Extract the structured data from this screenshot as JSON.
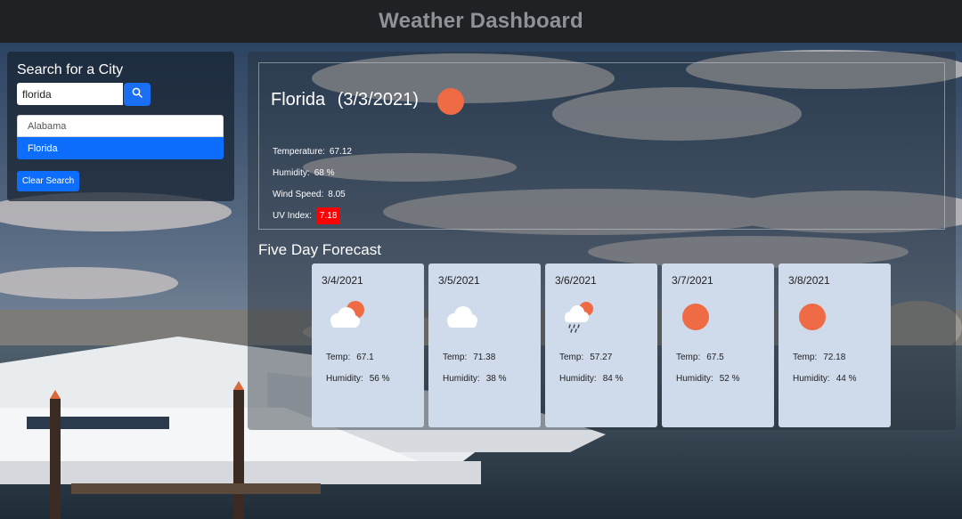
{
  "header": {
    "title": "Weather Dashboard"
  },
  "search": {
    "title": "Search for a City",
    "input_value": "florida",
    "history": [
      "Alabama",
      "Florida"
    ],
    "active_index": 1,
    "clear_label": "Clear Search"
  },
  "current": {
    "city": "Florida",
    "date": "(3/3/2021)",
    "icon": "sun-icon",
    "temperature_label": "Temperature:",
    "temperature": "67.12",
    "humidity_label": "Humidity:",
    "humidity": "68 %",
    "wind_label": "Wind Speed:",
    "wind": "8.05",
    "uv_label": "UV Index:",
    "uv": "7.18",
    "uv_color": "#ff0000"
  },
  "forecast": {
    "title": "Five Day Forecast",
    "temp_label": "Temp:",
    "humidity_label": "Humidity:",
    "days": [
      {
        "date": "3/4/2021",
        "icon": "partly-cloudy-icon",
        "temp": "67.1",
        "humidity": "56 %"
      },
      {
        "date": "3/5/2021",
        "icon": "cloud-icon",
        "temp": "71.38",
        "humidity": "38 %"
      },
      {
        "date": "3/6/2021",
        "icon": "rain-cloud-sun-icon",
        "temp": "57.27",
        "humidity": "84 %"
      },
      {
        "date": "3/7/2021",
        "icon": "sun-icon",
        "temp": "67.5",
        "humidity": "52 %"
      },
      {
        "date": "3/8/2021",
        "icon": "sun-icon",
        "temp": "72.18",
        "humidity": "44 %"
      }
    ]
  },
  "colors": {
    "accent": "#0d6efd",
    "sun": "#ee6b45",
    "card": "#cfdaea",
    "header": "#1f2124"
  }
}
